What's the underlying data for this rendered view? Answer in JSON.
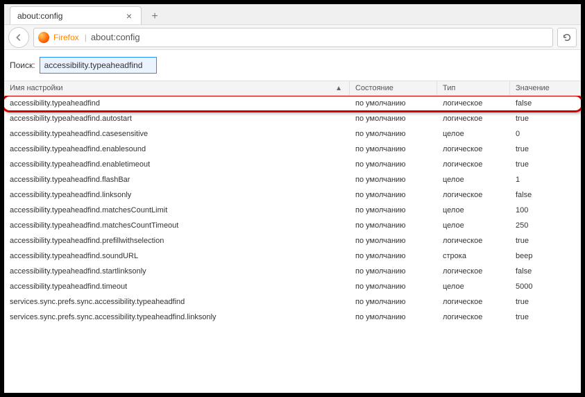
{
  "tab": {
    "title": "about:config"
  },
  "urlbar": {
    "brand": "Firefox",
    "url": "about:config"
  },
  "search": {
    "label": "Поиск:",
    "value": "accessibility.typeaheadfind"
  },
  "columns": {
    "name": "Имя настройки",
    "state": "Состояние",
    "type": "Тип",
    "value": "Значение"
  },
  "rows": [
    {
      "name": "accessibility.typeaheadfind",
      "state": "по умолчанию",
      "type": "логическое",
      "value": "false"
    },
    {
      "name": "accessibility.typeaheadfind.autostart",
      "state": "по умолчанию",
      "type": "логическое",
      "value": "true"
    },
    {
      "name": "accessibility.typeaheadfind.casesensitive",
      "state": "по умолчанию",
      "type": "целое",
      "value": "0"
    },
    {
      "name": "accessibility.typeaheadfind.enablesound",
      "state": "по умолчанию",
      "type": "логическое",
      "value": "true"
    },
    {
      "name": "accessibility.typeaheadfind.enabletimeout",
      "state": "по умолчанию",
      "type": "логическое",
      "value": "true"
    },
    {
      "name": "accessibility.typeaheadfind.flashBar",
      "state": "по умолчанию",
      "type": "целое",
      "value": "1"
    },
    {
      "name": "accessibility.typeaheadfind.linksonly",
      "state": "по умолчанию",
      "type": "логическое",
      "value": "false"
    },
    {
      "name": "accessibility.typeaheadfind.matchesCountLimit",
      "state": "по умолчанию",
      "type": "целое",
      "value": "100"
    },
    {
      "name": "accessibility.typeaheadfind.matchesCountTimeout",
      "state": "по умолчанию",
      "type": "целое",
      "value": "250"
    },
    {
      "name": "accessibility.typeaheadfind.prefillwithselection",
      "state": "по умолчанию",
      "type": "логическое",
      "value": "true"
    },
    {
      "name": "accessibility.typeaheadfind.soundURL",
      "state": "по умолчанию",
      "type": "строка",
      "value": "beep"
    },
    {
      "name": "accessibility.typeaheadfind.startlinksonly",
      "state": "по умолчанию",
      "type": "логическое",
      "value": "false"
    },
    {
      "name": "accessibility.typeaheadfind.timeout",
      "state": "по умолчанию",
      "type": "целое",
      "value": "5000"
    },
    {
      "name": "services.sync.prefs.sync.accessibility.typeaheadfind",
      "state": "по умолчанию",
      "type": "логическое",
      "value": "true"
    },
    {
      "name": "services.sync.prefs.sync.accessibility.typeaheadfind.linksonly",
      "state": "по умолчанию",
      "type": "логическое",
      "value": "true"
    }
  ],
  "highlighted_row_index": 0
}
